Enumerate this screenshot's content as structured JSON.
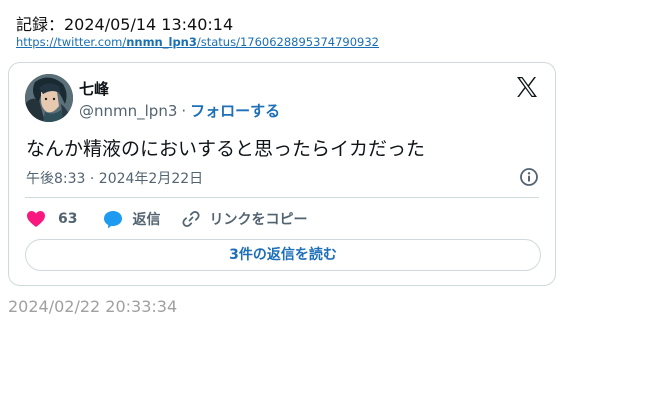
{
  "record": {
    "label": "記録：2024/05/14 13:40:14",
    "link_prefix": "https://twitter.com/",
    "link_user": "nnmn_lpn3",
    "link_suffix": "/status/1760628895374790932"
  },
  "tweet": {
    "display_name": "七峰",
    "handle": "@nnmn_lpn3",
    "separator": "·",
    "follow_label": "フォローする",
    "text": "なんか精液のにおいすると思ったらイカだった",
    "timestamp": "午後8:33 · 2024年2月22日",
    "like_count": "63",
    "reply_label": "返信",
    "copy_link_label": "リンクをコピー",
    "read_replies_label": "3件の返信を読む"
  },
  "footer": {
    "timestamp": "2024/02/22 20:33:34"
  },
  "icons": {
    "logo": "x-logo-icon",
    "info": "info-icon",
    "like": "heart-icon",
    "reply": "speech-bubble-icon",
    "link": "link-icon"
  },
  "colors": {
    "accent": "#1d70b8",
    "like": "#f91880",
    "reply_bubble": "#1d9bf0",
    "muted": "#536471",
    "border": "#cfd9de"
  }
}
